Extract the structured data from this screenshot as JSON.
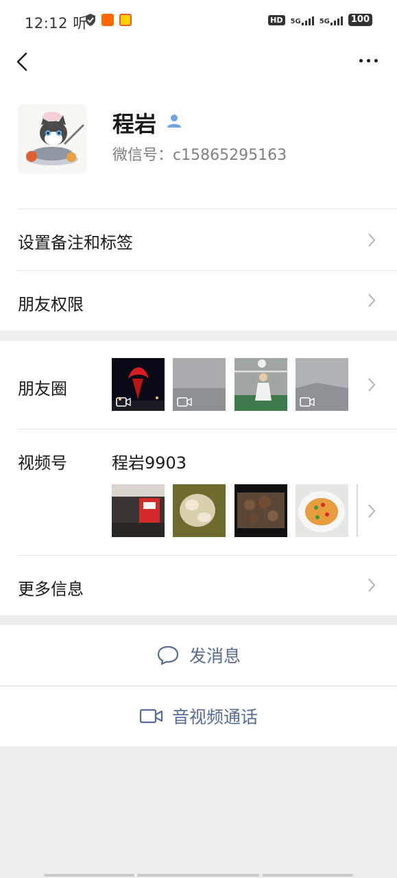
{
  "status_bar": {
    "time": "12:12",
    "ting": "听",
    "hd": "HD",
    "sim1": "5G",
    "sim2": "5G",
    "battery": "100"
  },
  "profile": {
    "name": "程岩",
    "wechat_id": "微信号：c15865295163"
  },
  "menu": {
    "set_remark": "设置备注和标签",
    "friend_permissions": "朋友权限",
    "moments": "朋友圈",
    "channels": "视频号",
    "channels_name": "程岩9903",
    "more_info": "更多信息"
  },
  "actions": {
    "send_message": "发消息",
    "av_call": "音视频通话"
  },
  "colors": {
    "link_blue": "#576b95",
    "bg_gray": "#ededed"
  }
}
